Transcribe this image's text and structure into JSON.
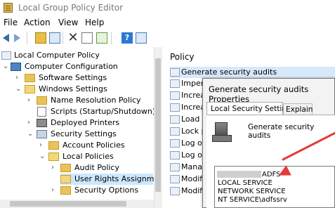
{
  "window": {
    "title": "Local Group Policy Editor"
  },
  "menu": {
    "items": [
      "File",
      "Action",
      "View",
      "Help"
    ]
  },
  "toolbar": {
    "icons": [
      "back-arrow-icon",
      "forward-arrow-icon",
      "up-folder-icon",
      "show-hide-tree-icon",
      "delete-icon",
      "properties-icon",
      "export-list-icon",
      "help-icon",
      "console-icon"
    ]
  },
  "tree": {
    "items": [
      "Local Computer Policy",
      "Computer Configuration",
      "Software Settings",
      "Windows Settings",
      "Name Resolution Policy",
      "Scripts (Startup/Shutdown)",
      "Deployed Printers",
      "Security Settings",
      "Account Policies",
      "Local Policies",
      "Audit Policy",
      "User Rights Assignme",
      "Security Options"
    ]
  },
  "policies": {
    "header": "Policy",
    "items": [
      "Generate security audits",
      "Imper",
      "Increa",
      "Increa",
      "Load a",
      "Lock p",
      "Log o",
      "Log o",
      "Mana",
      "Modif",
      "Modif"
    ]
  },
  "dialog": {
    "title": "Generate security audits Properties",
    "tabs": [
      "Local Security Setting",
      "Explain"
    ],
    "description": "Generate security audits",
    "entries": [
      "ADFS",
      "LOCAL SERVICE",
      "NETWORK SERVICE",
      "NT SERVICE\\adfssrv"
    ]
  },
  "colors": {
    "selection": "#cce8ff",
    "annotation_arrow": "#e23b3b"
  }
}
